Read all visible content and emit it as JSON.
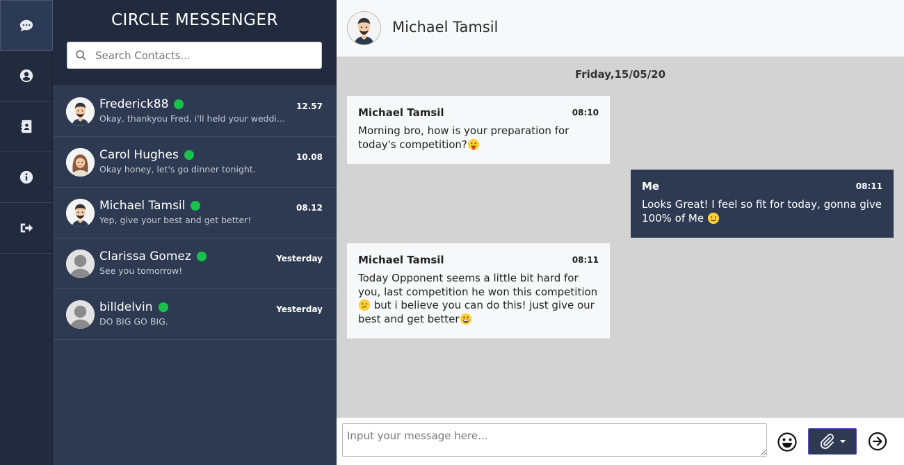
{
  "app": {
    "title": "CIRCLE MESSENGER"
  },
  "rail": [
    {
      "icon": "chat-bubble-icon",
      "active": true
    },
    {
      "icon": "user-circle-icon",
      "active": false
    },
    {
      "icon": "address-book-icon",
      "active": false
    },
    {
      "icon": "info-icon",
      "active": false
    },
    {
      "icon": "sign-out-icon",
      "active": false
    }
  ],
  "search": {
    "placeholder": "Search Contacts..."
  },
  "contacts": [
    {
      "name": "Frederick88",
      "time": "12.57",
      "preview": "Okay, thankyou Fred, i'll held your wedding...",
      "online": true,
      "avatar": "man-avatar"
    },
    {
      "name": "Carol Hughes",
      "time": "10.08",
      "preview": "Okay honey, let's go dinner tonight.",
      "online": true,
      "avatar": "woman-avatar"
    },
    {
      "name": "Michael Tamsil",
      "time": "08.12",
      "preview": "Yep, give your best and get better!",
      "online": true,
      "avatar": "man-avatar"
    },
    {
      "name": "Clarissa Gomez",
      "time": "Yesterday",
      "preview": "See you tomorrow!",
      "online": true,
      "avatar": "default-avatar"
    },
    {
      "name": "billdelvin",
      "time": "Yesterday",
      "preview": "DO BIG GO BIG.",
      "online": true,
      "avatar": "default-avatar"
    }
  ],
  "chat": {
    "contact_name": "Michael Tamsil",
    "date": "Friday,15/05/20",
    "messages": [
      {
        "sender": "Michael Tamsil",
        "time": "08:10",
        "text": "Morning bro, how is your preparation for today's competition?",
        "emoji_end": "tongue-emoji",
        "direction": "in"
      },
      {
        "sender": "Me",
        "time": "08:11",
        "text": "Looks Great! I feel so fit for today, gonna give 100% of Me",
        "emoji_end": "smile-emoji",
        "direction": "out"
      },
      {
        "sender": "Michael Tamsil",
        "time": "08:11",
        "text_before": "Today Opponent seems a little bit hard for you, last competition he won this competition",
        "emoji_mid": "confused-emoji",
        "text_after": "but i believe you can do this! just give our best and get better",
        "emoji_end": "grin-emoji",
        "direction": "in"
      }
    ]
  },
  "composer": {
    "placeholder": "Input your message here..."
  },
  "colors": {
    "rail_bg": "#222b3e",
    "sidebar_bg": "#2e3a52",
    "online": "#16c24a",
    "chat_bg": "#d3d3d3"
  }
}
